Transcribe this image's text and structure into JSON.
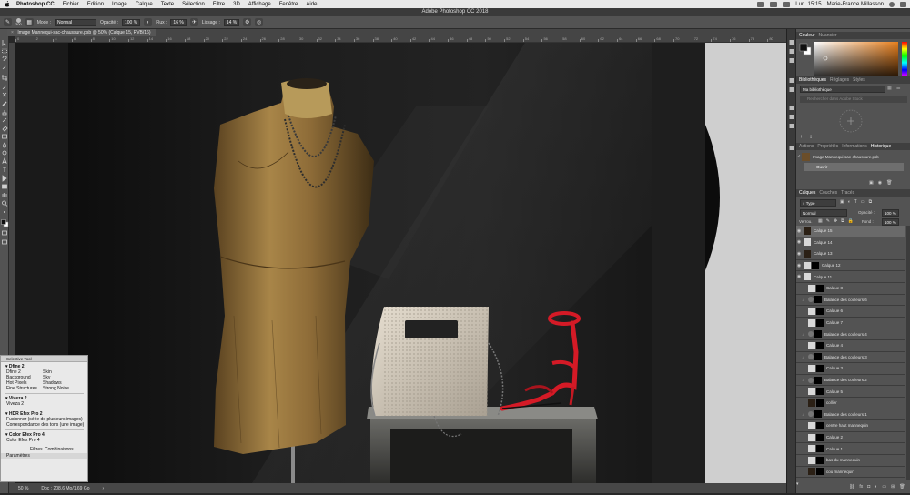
{
  "menubar": {
    "app": "Photoshop CC",
    "items": [
      "Fichier",
      "Edition",
      "Image",
      "Calque",
      "Texte",
      "Sélection",
      "Filtre",
      "3D",
      "Affichage",
      "Fenêtre",
      "Aide"
    ],
    "clock": "Lun. 15:15",
    "user": "Marie-France Millasson"
  },
  "titlebar": {
    "title": "Adobe Photoshop CC 2018"
  },
  "options": {
    "brush_size": "300",
    "mode_label": "Mode :",
    "mode_value": "Normal",
    "opacity_label": "Opacité :",
    "opacity_value": "100 %",
    "flux_label": "Flux :",
    "flux_value": "16 %",
    "lissage_label": "Lissage :",
    "lissage_value": "14 %"
  },
  "document": {
    "tab_title": "Image Mannequi-sac-chaussure.psb @ 50% (Calque 15, RVB/16)"
  },
  "ruler_ticks": [
    "0",
    "2",
    "4",
    "6",
    "8",
    "10",
    "12",
    "14",
    "16",
    "18",
    "20",
    "22",
    "24",
    "26",
    "28",
    "30",
    "32",
    "34",
    "36",
    "38",
    "40",
    "42",
    "44",
    "46",
    "48",
    "50",
    "52",
    "54",
    "56",
    "58",
    "60",
    "62",
    "64",
    "66",
    "68",
    "70",
    "72",
    "74",
    "76",
    "78",
    "80"
  ],
  "status": {
    "zoom": "50 %",
    "doc_info": "Doc : 208,6 Mo/1,69 Go"
  },
  "color_panel": {
    "tabs": [
      "Couleur",
      "Nuancier"
    ]
  },
  "libraries": {
    "tabs": [
      "Bibliothèques",
      "Réglages",
      "Styles"
    ],
    "dropdown": "Ma bibliothèque",
    "search_placeholder": "Rechercher dans Adobe Stock"
  },
  "history_panel": {
    "tabs": [
      "Actions",
      "Propriétés",
      "Informations",
      "Historique"
    ],
    "snapshot": "Image Mannequi-sac-chaussure.psb",
    "step": "Ouvrir"
  },
  "layers_panel": {
    "tabs": [
      "Calques",
      "Couches",
      "Tracés"
    ],
    "filter": "Type",
    "blend_mode": "Normal",
    "opacity_label": "Opacité :",
    "opacity_value": "100 %",
    "lock_label": "Verrou. :",
    "fill_label": "Fond :",
    "fill_value": "100 %",
    "layers": [
      {
        "name": "Calque 15",
        "thumb": "dark",
        "mask": false,
        "eye": true
      },
      {
        "name": "Calque 14",
        "thumb": "light",
        "mask": false,
        "eye": true
      },
      {
        "name": "Calque 13",
        "thumb": "dark",
        "mask": false,
        "eye": true
      },
      {
        "name": "Calque 12",
        "thumb": "light",
        "mask": true,
        "eye": true
      },
      {
        "name": "Calque 11",
        "thumb": "light",
        "mask": false,
        "eye": true
      },
      {
        "name": "Calque 8",
        "thumb": "light",
        "mask": true,
        "eye": false
      },
      {
        "name": "Balance des couleurs 6",
        "thumb": "adj",
        "mask": true,
        "eye": false
      },
      {
        "name": "Calque 6",
        "thumb": "light",
        "mask": true,
        "eye": false
      },
      {
        "name": "Calque 7",
        "thumb": "light",
        "mask": true,
        "eye": false
      },
      {
        "name": "Balance des couleurs 4",
        "thumb": "adj",
        "mask": true,
        "eye": false
      },
      {
        "name": "Calque 4",
        "thumb": "light",
        "mask": true,
        "eye": false
      },
      {
        "name": "Balance des couleurs 3",
        "thumb": "adj",
        "mask": true,
        "eye": false
      },
      {
        "name": "Calque 3",
        "thumb": "light",
        "mask": true,
        "eye": false
      },
      {
        "name": "Balance des couleurs 2",
        "thumb": "adj",
        "mask": true,
        "eye": false
      },
      {
        "name": "Calque 5",
        "thumb": "light",
        "mask": true,
        "eye": false
      },
      {
        "name": "collier",
        "thumb": "dark",
        "mask": true,
        "eye": false
      },
      {
        "name": "Balance des couleurs 1",
        "thumb": "adj",
        "mask": true,
        "eye": false
      },
      {
        "name": "centre haut mannequin",
        "thumb": "light",
        "mask": true,
        "eye": false
      },
      {
        "name": "Calque 2",
        "thumb": "light",
        "mask": true,
        "eye": false
      },
      {
        "name": "Calque 1",
        "thumb": "light",
        "mask": true,
        "eye": false
      },
      {
        "name": "bas du mannequin",
        "thumb": "light",
        "mask": true,
        "eye": false
      },
      {
        "name": "cou mannequin",
        "thumb": "dark",
        "mask": true,
        "eye": false
      }
    ]
  },
  "plugin": {
    "title": "Selective Tool",
    "dfine": {
      "title": "Dfine 2",
      "rows": [
        [
          "Dfine 2",
          "Skin"
        ],
        [
          "Background",
          "Sky"
        ],
        [
          "Hot Pixels",
          "Shadows"
        ],
        [
          "Fine Structures",
          "Strong Noise"
        ]
      ]
    },
    "viveza": {
      "title": "Viveza 2",
      "item": "Viveza 2"
    },
    "hdr": {
      "title": "HDR Efex Pro 2",
      "items": [
        "Fusionner (série de plusieurs images)",
        "Correspondance des tons (une image)"
      ]
    },
    "color": {
      "title": "Color Efex Pro 4",
      "item": "Color Efex Pro 4"
    },
    "footer": {
      "col1": "Filtres",
      "col2": "Combinaisons"
    },
    "params": "Paramètres"
  },
  "colors": {
    "chrome": "#535353",
    "canvas_bg": "#101010",
    "shoe": "#d41a26",
    "mannequin": "#9b7840",
    "bag": "#d8cfc0",
    "picker_hue": "#e8801e"
  }
}
